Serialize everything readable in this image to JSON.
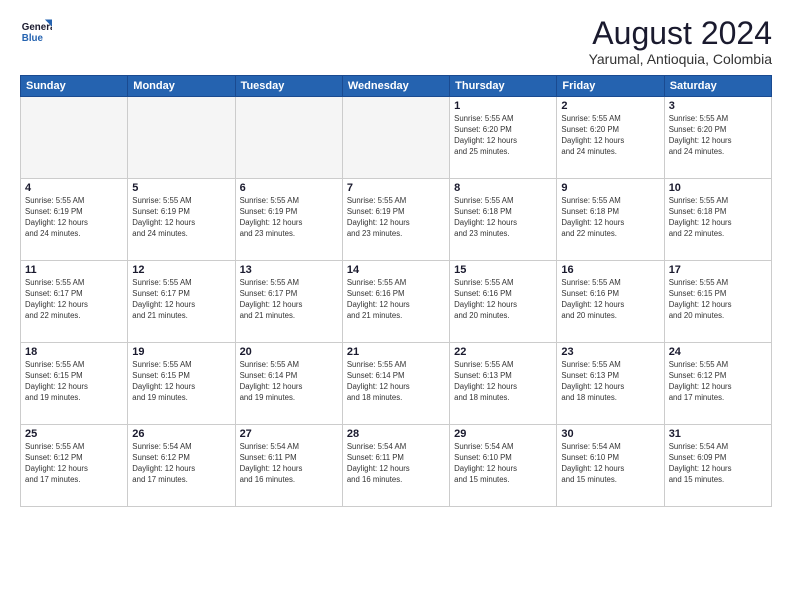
{
  "logo": {
    "line1": "General",
    "line2": "Blue"
  },
  "title": "August 2024",
  "subtitle": "Yarumal, Antioquia, Colombia",
  "days_of_week": [
    "Sunday",
    "Monday",
    "Tuesday",
    "Wednesday",
    "Thursday",
    "Friday",
    "Saturday"
  ],
  "weeks": [
    [
      {
        "day": "",
        "info": ""
      },
      {
        "day": "",
        "info": ""
      },
      {
        "day": "",
        "info": ""
      },
      {
        "day": "",
        "info": ""
      },
      {
        "day": "1",
        "info": "Sunrise: 5:55 AM\nSunset: 6:20 PM\nDaylight: 12 hours\nand 25 minutes."
      },
      {
        "day": "2",
        "info": "Sunrise: 5:55 AM\nSunset: 6:20 PM\nDaylight: 12 hours\nand 24 minutes."
      },
      {
        "day": "3",
        "info": "Sunrise: 5:55 AM\nSunset: 6:20 PM\nDaylight: 12 hours\nand 24 minutes."
      }
    ],
    [
      {
        "day": "4",
        "info": "Sunrise: 5:55 AM\nSunset: 6:19 PM\nDaylight: 12 hours\nand 24 minutes."
      },
      {
        "day": "5",
        "info": "Sunrise: 5:55 AM\nSunset: 6:19 PM\nDaylight: 12 hours\nand 24 minutes."
      },
      {
        "day": "6",
        "info": "Sunrise: 5:55 AM\nSunset: 6:19 PM\nDaylight: 12 hours\nand 23 minutes."
      },
      {
        "day": "7",
        "info": "Sunrise: 5:55 AM\nSunset: 6:19 PM\nDaylight: 12 hours\nand 23 minutes."
      },
      {
        "day": "8",
        "info": "Sunrise: 5:55 AM\nSunset: 6:18 PM\nDaylight: 12 hours\nand 23 minutes."
      },
      {
        "day": "9",
        "info": "Sunrise: 5:55 AM\nSunset: 6:18 PM\nDaylight: 12 hours\nand 22 minutes."
      },
      {
        "day": "10",
        "info": "Sunrise: 5:55 AM\nSunset: 6:18 PM\nDaylight: 12 hours\nand 22 minutes."
      }
    ],
    [
      {
        "day": "11",
        "info": "Sunrise: 5:55 AM\nSunset: 6:17 PM\nDaylight: 12 hours\nand 22 minutes."
      },
      {
        "day": "12",
        "info": "Sunrise: 5:55 AM\nSunset: 6:17 PM\nDaylight: 12 hours\nand 21 minutes."
      },
      {
        "day": "13",
        "info": "Sunrise: 5:55 AM\nSunset: 6:17 PM\nDaylight: 12 hours\nand 21 minutes."
      },
      {
        "day": "14",
        "info": "Sunrise: 5:55 AM\nSunset: 6:16 PM\nDaylight: 12 hours\nand 21 minutes."
      },
      {
        "day": "15",
        "info": "Sunrise: 5:55 AM\nSunset: 6:16 PM\nDaylight: 12 hours\nand 20 minutes."
      },
      {
        "day": "16",
        "info": "Sunrise: 5:55 AM\nSunset: 6:16 PM\nDaylight: 12 hours\nand 20 minutes."
      },
      {
        "day": "17",
        "info": "Sunrise: 5:55 AM\nSunset: 6:15 PM\nDaylight: 12 hours\nand 20 minutes."
      }
    ],
    [
      {
        "day": "18",
        "info": "Sunrise: 5:55 AM\nSunset: 6:15 PM\nDaylight: 12 hours\nand 19 minutes."
      },
      {
        "day": "19",
        "info": "Sunrise: 5:55 AM\nSunset: 6:15 PM\nDaylight: 12 hours\nand 19 minutes."
      },
      {
        "day": "20",
        "info": "Sunrise: 5:55 AM\nSunset: 6:14 PM\nDaylight: 12 hours\nand 19 minutes."
      },
      {
        "day": "21",
        "info": "Sunrise: 5:55 AM\nSunset: 6:14 PM\nDaylight: 12 hours\nand 18 minutes."
      },
      {
        "day": "22",
        "info": "Sunrise: 5:55 AM\nSunset: 6:13 PM\nDaylight: 12 hours\nand 18 minutes."
      },
      {
        "day": "23",
        "info": "Sunrise: 5:55 AM\nSunset: 6:13 PM\nDaylight: 12 hours\nand 18 minutes."
      },
      {
        "day": "24",
        "info": "Sunrise: 5:55 AM\nSunset: 6:12 PM\nDaylight: 12 hours\nand 17 minutes."
      }
    ],
    [
      {
        "day": "25",
        "info": "Sunrise: 5:55 AM\nSunset: 6:12 PM\nDaylight: 12 hours\nand 17 minutes."
      },
      {
        "day": "26",
        "info": "Sunrise: 5:54 AM\nSunset: 6:12 PM\nDaylight: 12 hours\nand 17 minutes."
      },
      {
        "day": "27",
        "info": "Sunrise: 5:54 AM\nSunset: 6:11 PM\nDaylight: 12 hours\nand 16 minutes."
      },
      {
        "day": "28",
        "info": "Sunrise: 5:54 AM\nSunset: 6:11 PM\nDaylight: 12 hours\nand 16 minutes."
      },
      {
        "day": "29",
        "info": "Sunrise: 5:54 AM\nSunset: 6:10 PM\nDaylight: 12 hours\nand 15 minutes."
      },
      {
        "day": "30",
        "info": "Sunrise: 5:54 AM\nSunset: 6:10 PM\nDaylight: 12 hours\nand 15 minutes."
      },
      {
        "day": "31",
        "info": "Sunrise: 5:54 AM\nSunset: 6:09 PM\nDaylight: 12 hours\nand 15 minutes."
      }
    ]
  ]
}
